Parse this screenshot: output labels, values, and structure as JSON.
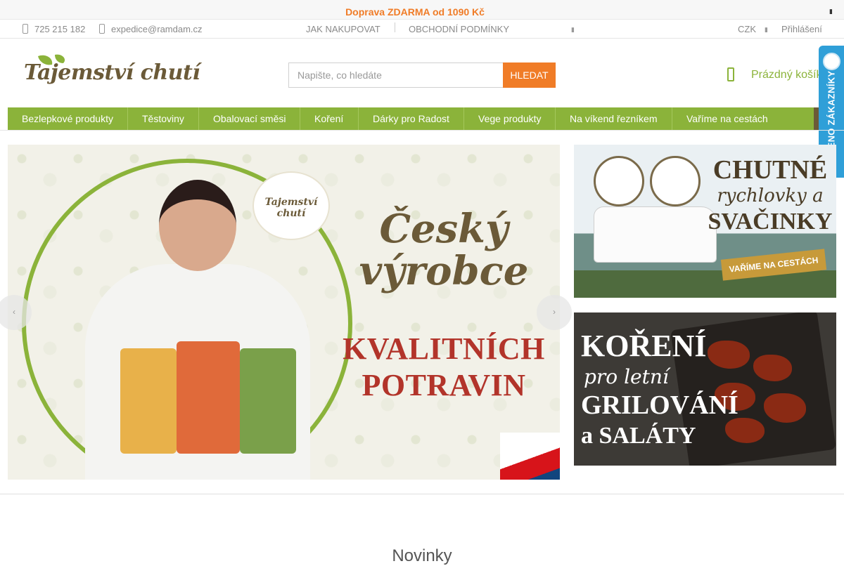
{
  "promo": {
    "text": "Doprava ZDARMA od 1090 Kč",
    "close_icon": "close-icon"
  },
  "topbar": {
    "phone": "725 215 182",
    "email": "expedice@ramdam.cz",
    "links": [
      "JAK NAKUPOVAT",
      "OBCHODNÍ PODMÍNKY"
    ],
    "currency": "CZK",
    "login": "Přihlášení"
  },
  "header": {
    "logo_text": "Tajemství chutí",
    "search": {
      "placeholder": "Napište, co hledáte",
      "button": "HLEDAT"
    },
    "cart": {
      "label": "Prázdný košík",
      "icon": "cart-icon"
    }
  },
  "badge": {
    "text": "OVĚŘENO ZÁKAZNÍKY"
  },
  "nav": {
    "items": [
      "Bezlepkové produkty",
      "Těstoviny",
      "Obalovací směsi",
      "Koření",
      "Dárky pro Radost",
      "Vege produkty",
      "Na víkend řezníkem",
      "Vaříme na cestách"
    ]
  },
  "hero": {
    "emblem": "Tajemství chutí",
    "headline": "Český výrobce",
    "subheadline": "KVALITNÍCH POTRAVIN",
    "prev_icon": "chevron-left-icon",
    "next_icon": "chevron-right-icon"
  },
  "banners": [
    {
      "line1": "CHUTNÉ",
      "line2": "rychlovky a",
      "line3": "SVAČINKY",
      "ribbon": "VAŘÍME NA CESTÁCH"
    },
    {
      "line1": "KOŘENÍ",
      "line2": "pro letní",
      "line3": "GRILOVÁNÍ",
      "line4": "a SALÁTY"
    }
  ],
  "section": {
    "title": "Novinky"
  },
  "colors": {
    "accent": "#f07c27",
    "green": "#8bb33a",
    "brown": "#6b5a38",
    "badge_blue": "#2f9fd8"
  }
}
